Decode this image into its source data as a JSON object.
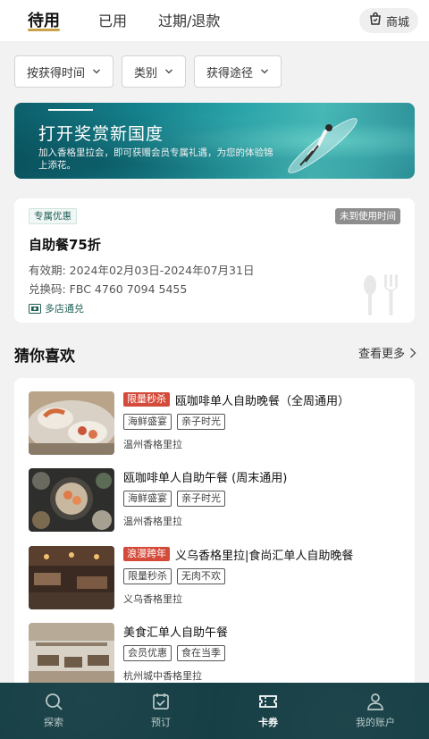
{
  "tabs": [
    {
      "label": "待用",
      "active": true
    },
    {
      "label": "已用",
      "active": false
    },
    {
      "label": "过期/退款",
      "active": false
    }
  ],
  "shop": {
    "label": "商城",
    "icon": "shopping-bag-icon"
  },
  "filters": [
    {
      "label": "按获得时间"
    },
    {
      "label": "类别"
    },
    {
      "label": "获得途径"
    }
  ],
  "banner": {
    "title": "打开奖赏新国度",
    "subtitle": "加入香格里拉会，即可获赠会员专属礼遇，为您的体验锦上添花。"
  },
  "coupon": {
    "tag": "专属优惠",
    "status": "未到使用时间",
    "name": "自助餐75折",
    "validity": "有效期: 2024年02月03日-2024年07月31日",
    "code": "兑换码: FBC 4760 7094 5455",
    "multi_store": "多店通兑"
  },
  "recommend": {
    "title": "猜你喜欢",
    "more": "查看更多",
    "items": [
      {
        "promo": "限量秒杀",
        "title": "瓯咖啡单人自助晚餐（全周通用）",
        "tags": [
          "海鲜盛宴",
          "亲子时光"
        ],
        "hotel": "温州香格里拉"
      },
      {
        "promo": "",
        "title": "瓯咖啡单人自助午餐 (周末通用)",
        "tags": [
          "海鲜盛宴",
          "亲子时光"
        ],
        "hotel": "温州香格里拉"
      },
      {
        "promo": "浪漫跨年",
        "title": "义乌香格里拉|食尚汇单人自助晚餐",
        "tags": [
          "限量秒杀",
          "无肉不欢"
        ],
        "hotel": "义乌香格里拉"
      },
      {
        "promo": "",
        "title": "美食汇单人自助午餐",
        "tags": [
          "会员优惠",
          "食在当季"
        ],
        "hotel": "杭州城中香格里拉"
      }
    ]
  },
  "nav": [
    {
      "label": "探索",
      "icon": "search-icon",
      "active": false
    },
    {
      "label": "预订",
      "icon": "calendar-check-icon",
      "active": false
    },
    {
      "label": "卡券",
      "icon": "ticket-icon",
      "active": true
    },
    {
      "label": "我的账户",
      "icon": "user-icon",
      "active": false
    }
  ],
  "colors": {
    "accent_gold": "#c9a24a",
    "brand_teal": "#163f45",
    "promo_red": "#d44b3b"
  }
}
